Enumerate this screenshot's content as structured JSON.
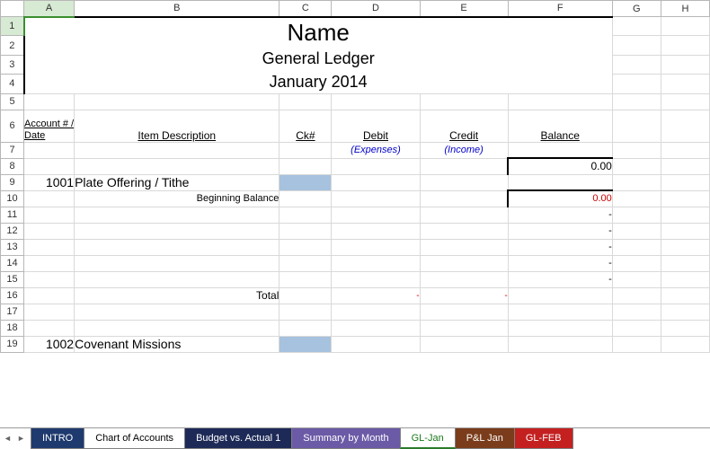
{
  "columns": [
    "A",
    "B",
    "C",
    "D",
    "E",
    "F",
    "G",
    "H"
  ],
  "title": {
    "line1": "Name",
    "line2": "General Ledger",
    "line3": "January 2014"
  },
  "headers": {
    "acct": "Account # / Date",
    "desc": "Item Description",
    "ck": "Ck#",
    "debit": "Debit",
    "credit": "Credit",
    "balance": "Balance"
  },
  "subheaders": {
    "debit": "(Expenses)",
    "credit": "(Income)"
  },
  "balance_start": "0.00",
  "section1": {
    "num": "1001",
    "title": "Plate Offering / Tithe",
    "beginning_label": "Beginning Balance",
    "beginning_value": "0.00",
    "rows": [
      {
        "f": "-"
      },
      {
        "f": "-"
      },
      {
        "f": "-"
      },
      {
        "f": "-"
      },
      {
        "f": "-"
      }
    ],
    "total_label": "Total",
    "total_d": "-",
    "total_e": "-"
  },
  "section2": {
    "num": "1002",
    "title": "Covenant Missions"
  },
  "tabs": [
    {
      "label": "INTRO",
      "cls": "c-blue"
    },
    {
      "label": "Chart of Accounts",
      "cls": "c-white"
    },
    {
      "label": "Budget vs. Actual 1",
      "cls": "c-navy"
    },
    {
      "label": "Summary by Month",
      "cls": "c-purple"
    },
    {
      "label": "GL-Jan",
      "cls": "c-green active"
    },
    {
      "label": "P&L Jan",
      "cls": "c-brown"
    },
    {
      "label": "GL-FEB",
      "cls": "c-red"
    }
  ]
}
